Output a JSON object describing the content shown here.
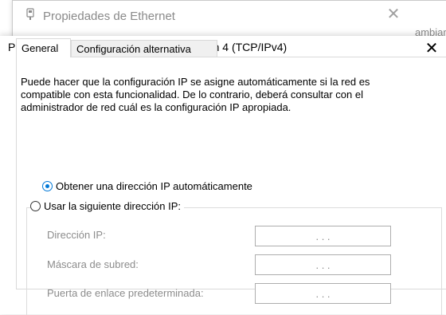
{
  "background_window": {
    "title": "Propiedades de Ethernet",
    "right_fragment": "ambiar"
  },
  "dialog": {
    "title": "Propiedades: Protocolo de Internet versión 4 (TCP/IPv4)",
    "close_glyph": "✕"
  },
  "tabs": [
    {
      "label": "General",
      "active": true
    },
    {
      "label": "Configuración alternativa",
      "active": false
    }
  ],
  "description": "Puede hacer que la configuración IP se asigne automáticamente si la red es compatible con esta funcionalidad. De lo contrario, deberá consultar con el administrador de red cuál es la configuración IP apropiada.",
  "ip_options": {
    "auto": {
      "label": "Obtener una dirección IP automáticamente",
      "checked": true
    },
    "manual": {
      "label": "Usar la siguiente dirección IP:",
      "checked": false
    }
  },
  "fields": [
    {
      "label": "Dirección IP:",
      "value": ". . ."
    },
    {
      "label": "Máscara de subred:",
      "value": ". . ."
    },
    {
      "label": "Puerta de enlace predeterminada:",
      "value": ". . ."
    }
  ],
  "colors": {
    "accent": "#0078d7",
    "disabled_text": "#8c8c8c"
  },
  "icons": {
    "bg_window": "network-adapter-icon",
    "close": "close-icon"
  }
}
